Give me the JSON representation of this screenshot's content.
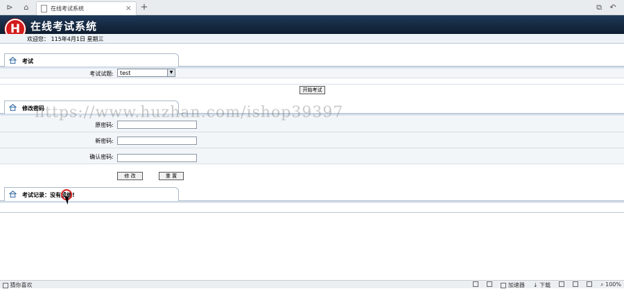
{
  "browser": {
    "tab_title": "在线考试系统",
    "tab_close": "×",
    "new_tab": "+"
  },
  "header": {
    "logo_text": "H",
    "title": "在线考试系统",
    "welcome": "欢迎您： 115年4月1日 星期三"
  },
  "exam": {
    "section_title": "考试",
    "subject_label": "考试试题:",
    "subject_value": "test",
    "start_button": "开始考试"
  },
  "password": {
    "section_title": "修改密码",
    "old_label": "原密码:",
    "new_label": "新密码:",
    "confirm_label": "确认密码:",
    "modify_button": "修 改",
    "reset_button": "重 置"
  },
  "records": {
    "section_title": "考试记录：没有成绩!"
  },
  "watermark": "https://www.huzhan.com/ishop39397",
  "status": {
    "left_text": "猜你喜欢",
    "accelerator": "加速器",
    "download": "下载",
    "zoom": "100%"
  }
}
